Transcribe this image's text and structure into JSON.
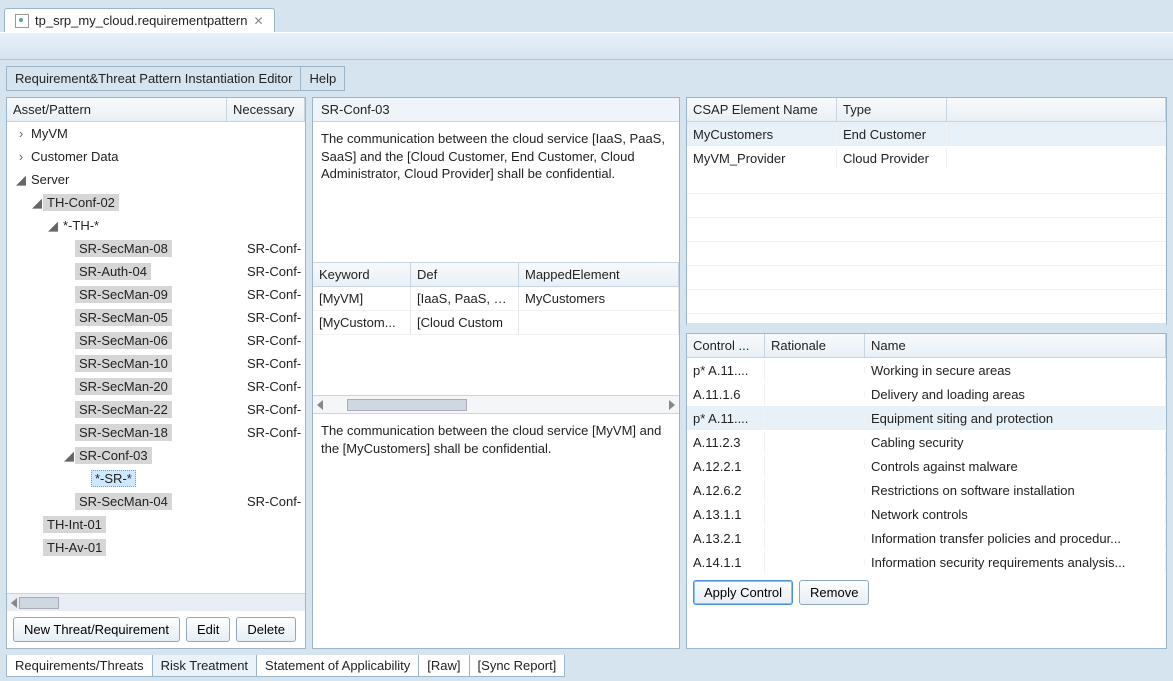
{
  "file_tab": {
    "name": "tp_srp_my_cloud.requirementpattern"
  },
  "menubar": {
    "editor": "Requirement&Threat Pattern Instantiation Editor",
    "help": "Help"
  },
  "tree": {
    "headers": [
      "Asset/Pattern",
      "Necessary"
    ],
    "rows": [
      {
        "indent": 0,
        "toggle": "›",
        "label": "MyVM",
        "hl": false
      },
      {
        "indent": 0,
        "toggle": "›",
        "label": "Customer Data",
        "hl": false
      },
      {
        "indent": 0,
        "toggle": "◢",
        "label": "Server",
        "hl": false
      },
      {
        "indent": 1,
        "toggle": "◢",
        "label": "TH-Conf-02",
        "hl": true
      },
      {
        "indent": 2,
        "toggle": "◢",
        "label": "*-TH-*",
        "hl": false
      },
      {
        "indent": 3,
        "toggle": "",
        "label": "SR-SecMan-08",
        "hl": true,
        "necessity": "SR-Conf-"
      },
      {
        "indent": 3,
        "toggle": "",
        "label": "SR-Auth-04",
        "hl": true,
        "necessity": "SR-Conf-"
      },
      {
        "indent": 3,
        "toggle": "",
        "label": "SR-SecMan-09",
        "hl": true,
        "necessity": "SR-Conf-"
      },
      {
        "indent": 3,
        "toggle": "",
        "label": "SR-SecMan-05",
        "hl": true,
        "necessity": "SR-Conf-"
      },
      {
        "indent": 3,
        "toggle": "",
        "label": "SR-SecMan-06",
        "hl": true,
        "necessity": "SR-Conf-"
      },
      {
        "indent": 3,
        "toggle": "",
        "label": "SR-SecMan-10",
        "hl": true,
        "necessity": "SR-Conf-"
      },
      {
        "indent": 3,
        "toggle": "",
        "label": "SR-SecMan-20",
        "hl": true,
        "necessity": "SR-Conf-"
      },
      {
        "indent": 3,
        "toggle": "",
        "label": "SR-SecMan-22",
        "hl": true,
        "necessity": "SR-Conf-"
      },
      {
        "indent": 3,
        "toggle": "",
        "label": "SR-SecMan-18",
        "hl": true,
        "necessity": "SR-Conf-"
      },
      {
        "indent": 3,
        "toggle": "◢",
        "label": "SR-Conf-03",
        "hl": true
      },
      {
        "indent": 4,
        "toggle": "",
        "label": "*-SR-*",
        "sel": true
      },
      {
        "indent": 3,
        "toggle": "",
        "label": "SR-SecMan-04",
        "hl": true,
        "necessity": "SR-Conf-"
      },
      {
        "indent": 1,
        "toggle": "",
        "label": "TH-Int-01",
        "hl": true
      },
      {
        "indent": 1,
        "toggle": "",
        "label": "TH-Av-01",
        "hl": true
      }
    ]
  },
  "left_buttons": {
    "new": "New Threat/Requirement",
    "edit": "Edit",
    "delete": "Delete"
  },
  "mid": {
    "title": "SR-Conf-03",
    "desc": "The communication between the cloud service [IaaS, PaaS, SaaS] and the [Cloud Customer, End Customer, Cloud Administrator, Cloud Provider] shall be confidential.",
    "keyword_headers": [
      "Keyword",
      "Def",
      "MappedElement"
    ],
    "keyword_rows": [
      {
        "kw": "[MyVM]",
        "def": "[IaaS, PaaS, Saa",
        "map": "MyCustomers"
      },
      {
        "kw": "[MyCustom...",
        "def": "[Cloud Custom",
        "map": ""
      }
    ],
    "result": "The communication between the cloud service [MyVM] and the [MyCustomers] shall be confidential."
  },
  "csap": {
    "headers": [
      "CSAP Element Name",
      "Type"
    ],
    "rows": [
      {
        "name": "MyCustomers",
        "type": "End Customer",
        "sel": true
      },
      {
        "name": "MyVM_Provider",
        "type": "Cloud Provider"
      }
    ]
  },
  "controls": {
    "headers": [
      "Control ...",
      "Rationale",
      "Name"
    ],
    "rows": [
      {
        "id": "p* A.11....",
        "rat": "",
        "name": "Working in secure areas"
      },
      {
        "id": "A.11.1.6",
        "rat": "",
        "name": "Delivery and loading areas"
      },
      {
        "id": "p* A.11....",
        "rat": "",
        "name": "Equipment siting and protection",
        "sel": true
      },
      {
        "id": "A.11.2.3",
        "rat": "",
        "name": "Cabling security"
      },
      {
        "id": "A.12.2.1",
        "rat": "",
        "name": "Controls against malware"
      },
      {
        "id": "A.12.6.2",
        "rat": "",
        "name": "Restrictions on software installation"
      },
      {
        "id": "A.13.1.1",
        "rat": "",
        "name": "Network controls"
      },
      {
        "id": "A.13.2.1",
        "rat": "",
        "name": "Information transfer policies and procedur..."
      },
      {
        "id": "A.14.1.1",
        "rat": "",
        "name": "Information security requirements analysis..."
      }
    ]
  },
  "right_buttons": {
    "apply": "Apply Control",
    "remove": "Remove"
  },
  "bottom_tabs": [
    "Requirements/Threats",
    "Risk Treatment",
    "Statement of Applicability",
    "[Raw]",
    "[Sync Report]"
  ]
}
